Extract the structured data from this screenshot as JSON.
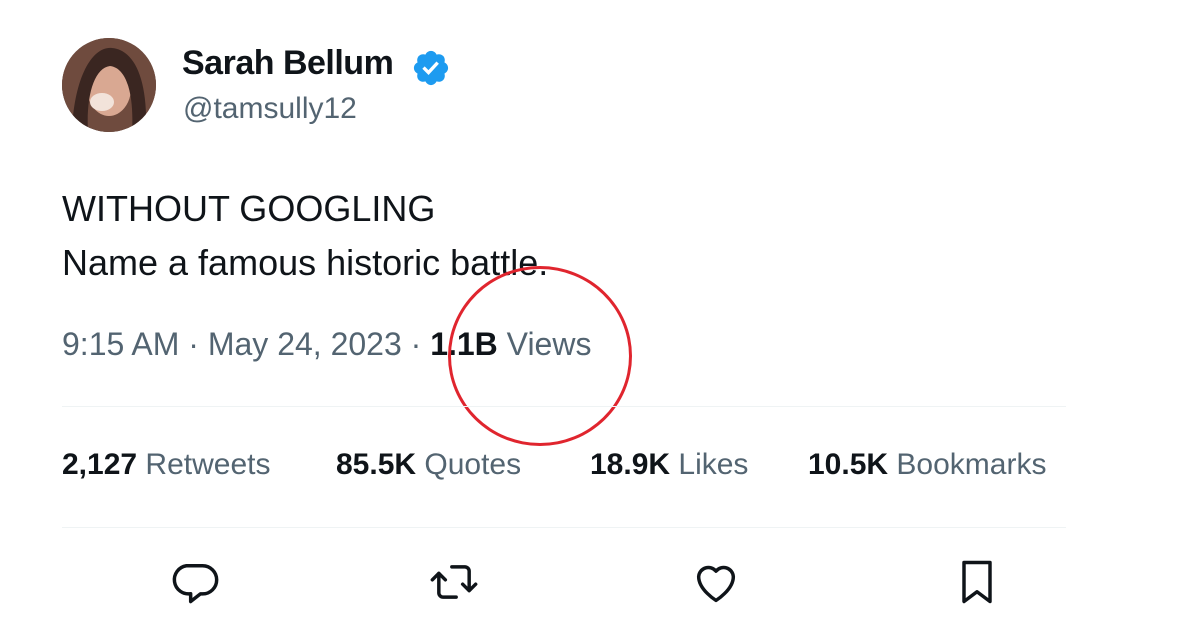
{
  "author": {
    "display_name": "Sarah Bellum",
    "handle": "@tamsully12",
    "verified_icon": "verified-badge-icon",
    "verified_color": "#1d9bf0"
  },
  "tweet": {
    "lines": [
      "WITHOUT GOOGLING",
      "Name a famous historic battle."
    ]
  },
  "meta": {
    "time": "9:15 AM",
    "separator1": " · ",
    "date": "May 24, 2023",
    "separator2": " · ",
    "views_count": "1.1B",
    "views_label": " Views"
  },
  "stats": [
    {
      "count": "2,127",
      "label": " Retweets"
    },
    {
      "count": "85.5K",
      "label": " Quotes"
    },
    {
      "count": "18.9K",
      "label": " Likes"
    },
    {
      "count": "10.5K",
      "label": " Bookmarks"
    }
  ],
  "actions": [
    {
      "icon": "reply-icon"
    },
    {
      "icon": "retweet-icon"
    },
    {
      "icon": "like-icon"
    },
    {
      "icon": "bookmark-icon"
    }
  ],
  "colors": {
    "text_primary": "#0f1419",
    "text_secondary": "#536471",
    "annotation_circle": "#e0252e",
    "divider": "#eff3f4"
  }
}
